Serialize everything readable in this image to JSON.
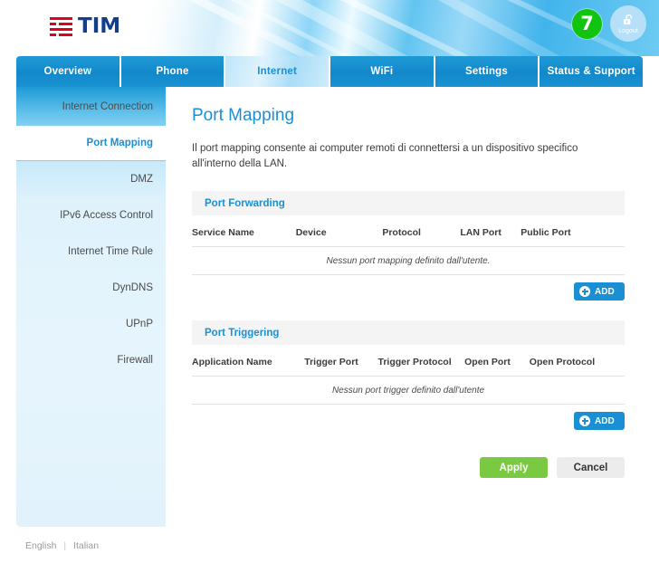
{
  "header": {
    "logo_text": "TIM",
    "logo_name": "tim-logo",
    "badge_count": "7",
    "logout_label": "Logout",
    "lock_icon": "open-padlock-icon"
  },
  "nav": {
    "tabs": [
      {
        "label": "Overview",
        "active": false
      },
      {
        "label": "Phone",
        "active": false
      },
      {
        "label": "Internet",
        "active": true
      },
      {
        "label": "WiFi",
        "active": false
      },
      {
        "label": "Settings",
        "active": false
      },
      {
        "label": "Status & Support",
        "active": false
      }
    ]
  },
  "sidebar": {
    "items": [
      {
        "label": "Internet Connection",
        "active": false
      },
      {
        "label": "Port Mapping",
        "active": true
      },
      {
        "label": "DMZ",
        "active": false
      },
      {
        "label": "IPv6 Access Control",
        "active": false
      },
      {
        "label": "Internet Time Rule",
        "active": false
      },
      {
        "label": "DynDNS",
        "active": false
      },
      {
        "label": "UPnP",
        "active": false
      },
      {
        "label": "Firewall",
        "active": false
      }
    ]
  },
  "main": {
    "title": "Port Mapping",
    "description": "Il port mapping consente ai computer remoti di connettersi a un dispositivo specifico all'interno della LAN.",
    "port_forwarding": {
      "heading": "Port Forwarding",
      "columns": [
        "Service Name",
        "Device",
        "Protocol",
        "LAN Port",
        "Public Port"
      ],
      "empty_message": "Nessun port mapping definito dall'utente.",
      "add_label": "ADD"
    },
    "port_triggering": {
      "heading": "Port Triggering",
      "columns": [
        "Application Name",
        "Trigger Port",
        "Trigger Protocol",
        "Open Port",
        "Open Protocol"
      ],
      "empty_message": "Nessun port trigger definito dall'utente",
      "add_label": "ADD"
    },
    "apply_label": "Apply",
    "cancel_label": "Cancel"
  },
  "footer": {
    "english": "English",
    "divider": "|",
    "italian": "Italian"
  },
  "colors": {
    "accent_blue": "#1a8fd4",
    "tab_blue": "#1288cb",
    "apply_green": "#7ac943",
    "badge_green": "#10c40f",
    "logo_red": "#e2001a",
    "logo_navy": "#123f8c",
    "sidebar_bg": "#e2f2fc"
  }
}
